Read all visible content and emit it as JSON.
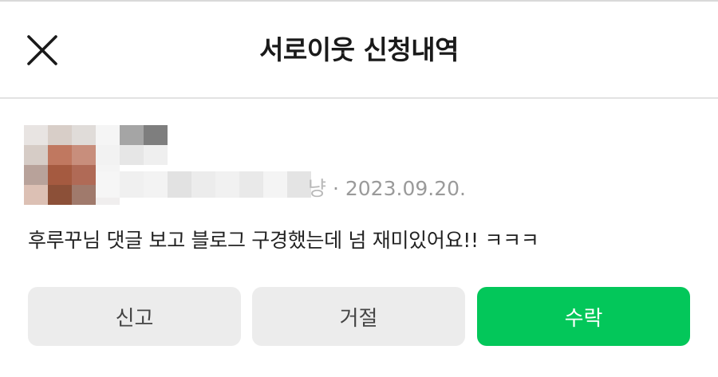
{
  "header": {
    "title": "서로이웃 신청내역",
    "close_icon": "close-icon"
  },
  "request": {
    "name_tail": "냥",
    "separator": "·",
    "date": "2023.09.20.",
    "message": "후루꾸님 댓글 보고 블로그 구경했는데 넘 재미있어요!! ㅋㅋㅋ"
  },
  "actions": {
    "report_label": "신고",
    "reject_label": "거절",
    "accept_label": "수락"
  },
  "colors": {
    "accent": "#03c75a",
    "button_gray": "#ececec",
    "divider": "#e2e2e2",
    "meta_text": "#9a9a9a"
  }
}
